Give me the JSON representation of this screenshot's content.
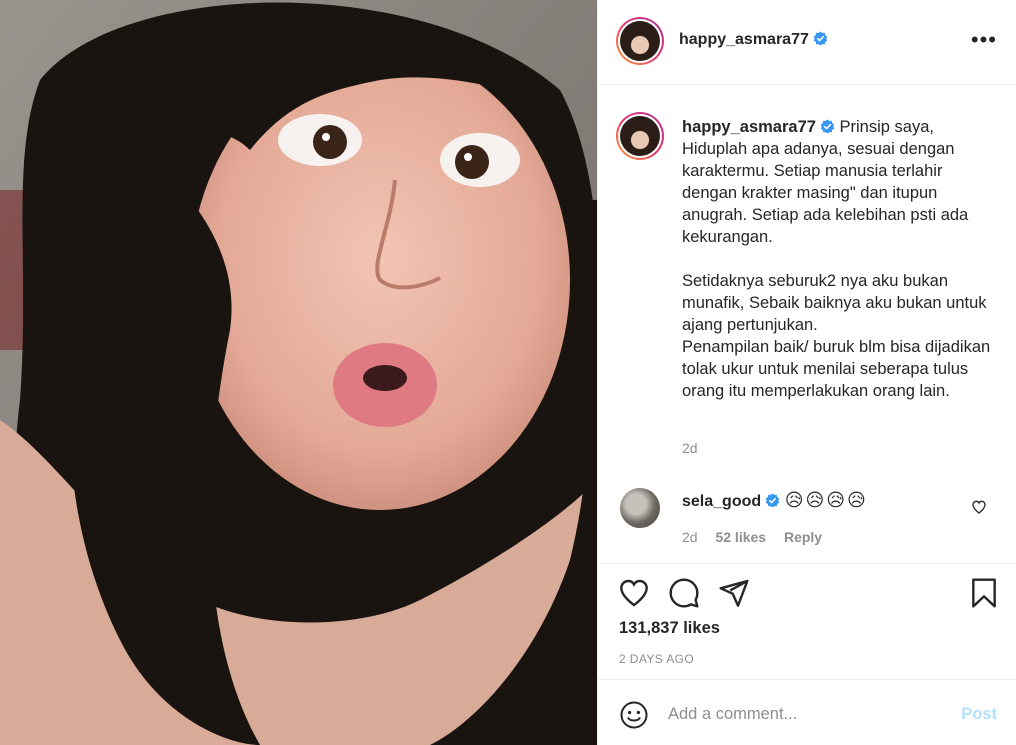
{
  "post": {
    "author": "happy_asmara77",
    "caption": "Prinsip saya,\nHiduplah apa adanya, sesuai dengan karaktermu. Setiap manusia terlahir dengan krakter masing\" dan itupun anugrah. Setiap ada kelebihan psti ada kekurangan.\n\nSetidaknya seburuk2 nya aku bukan munafik, Sebaik baiknya aku bukan untuk ajang pertunjukan.\nPenampilan baik/ buruk blm bisa dijadikan tolak ukur untuk menilai seberapa tulus orang itu memperlakukan orang lain.",
    "caption_time": "2d",
    "likes": "131,837 likes",
    "date": "2 DAYS AGO"
  },
  "comment": {
    "author": "sela_good",
    "text": "😥😥😥😥",
    "time": "2d",
    "likes": "52 likes",
    "reply": "Reply"
  },
  "add_comment": {
    "placeholder": "Add a comment...",
    "post_label": "Post"
  },
  "colors": {
    "verified": "#3897f0",
    "post_disabled": "#b2dffc",
    "secondary_text": "#8e8e8e"
  },
  "icons": [
    "more-options-icon",
    "verified-icon",
    "heart-icon",
    "comment-icon",
    "share-icon",
    "bookmark-icon",
    "emoji-icon"
  ]
}
